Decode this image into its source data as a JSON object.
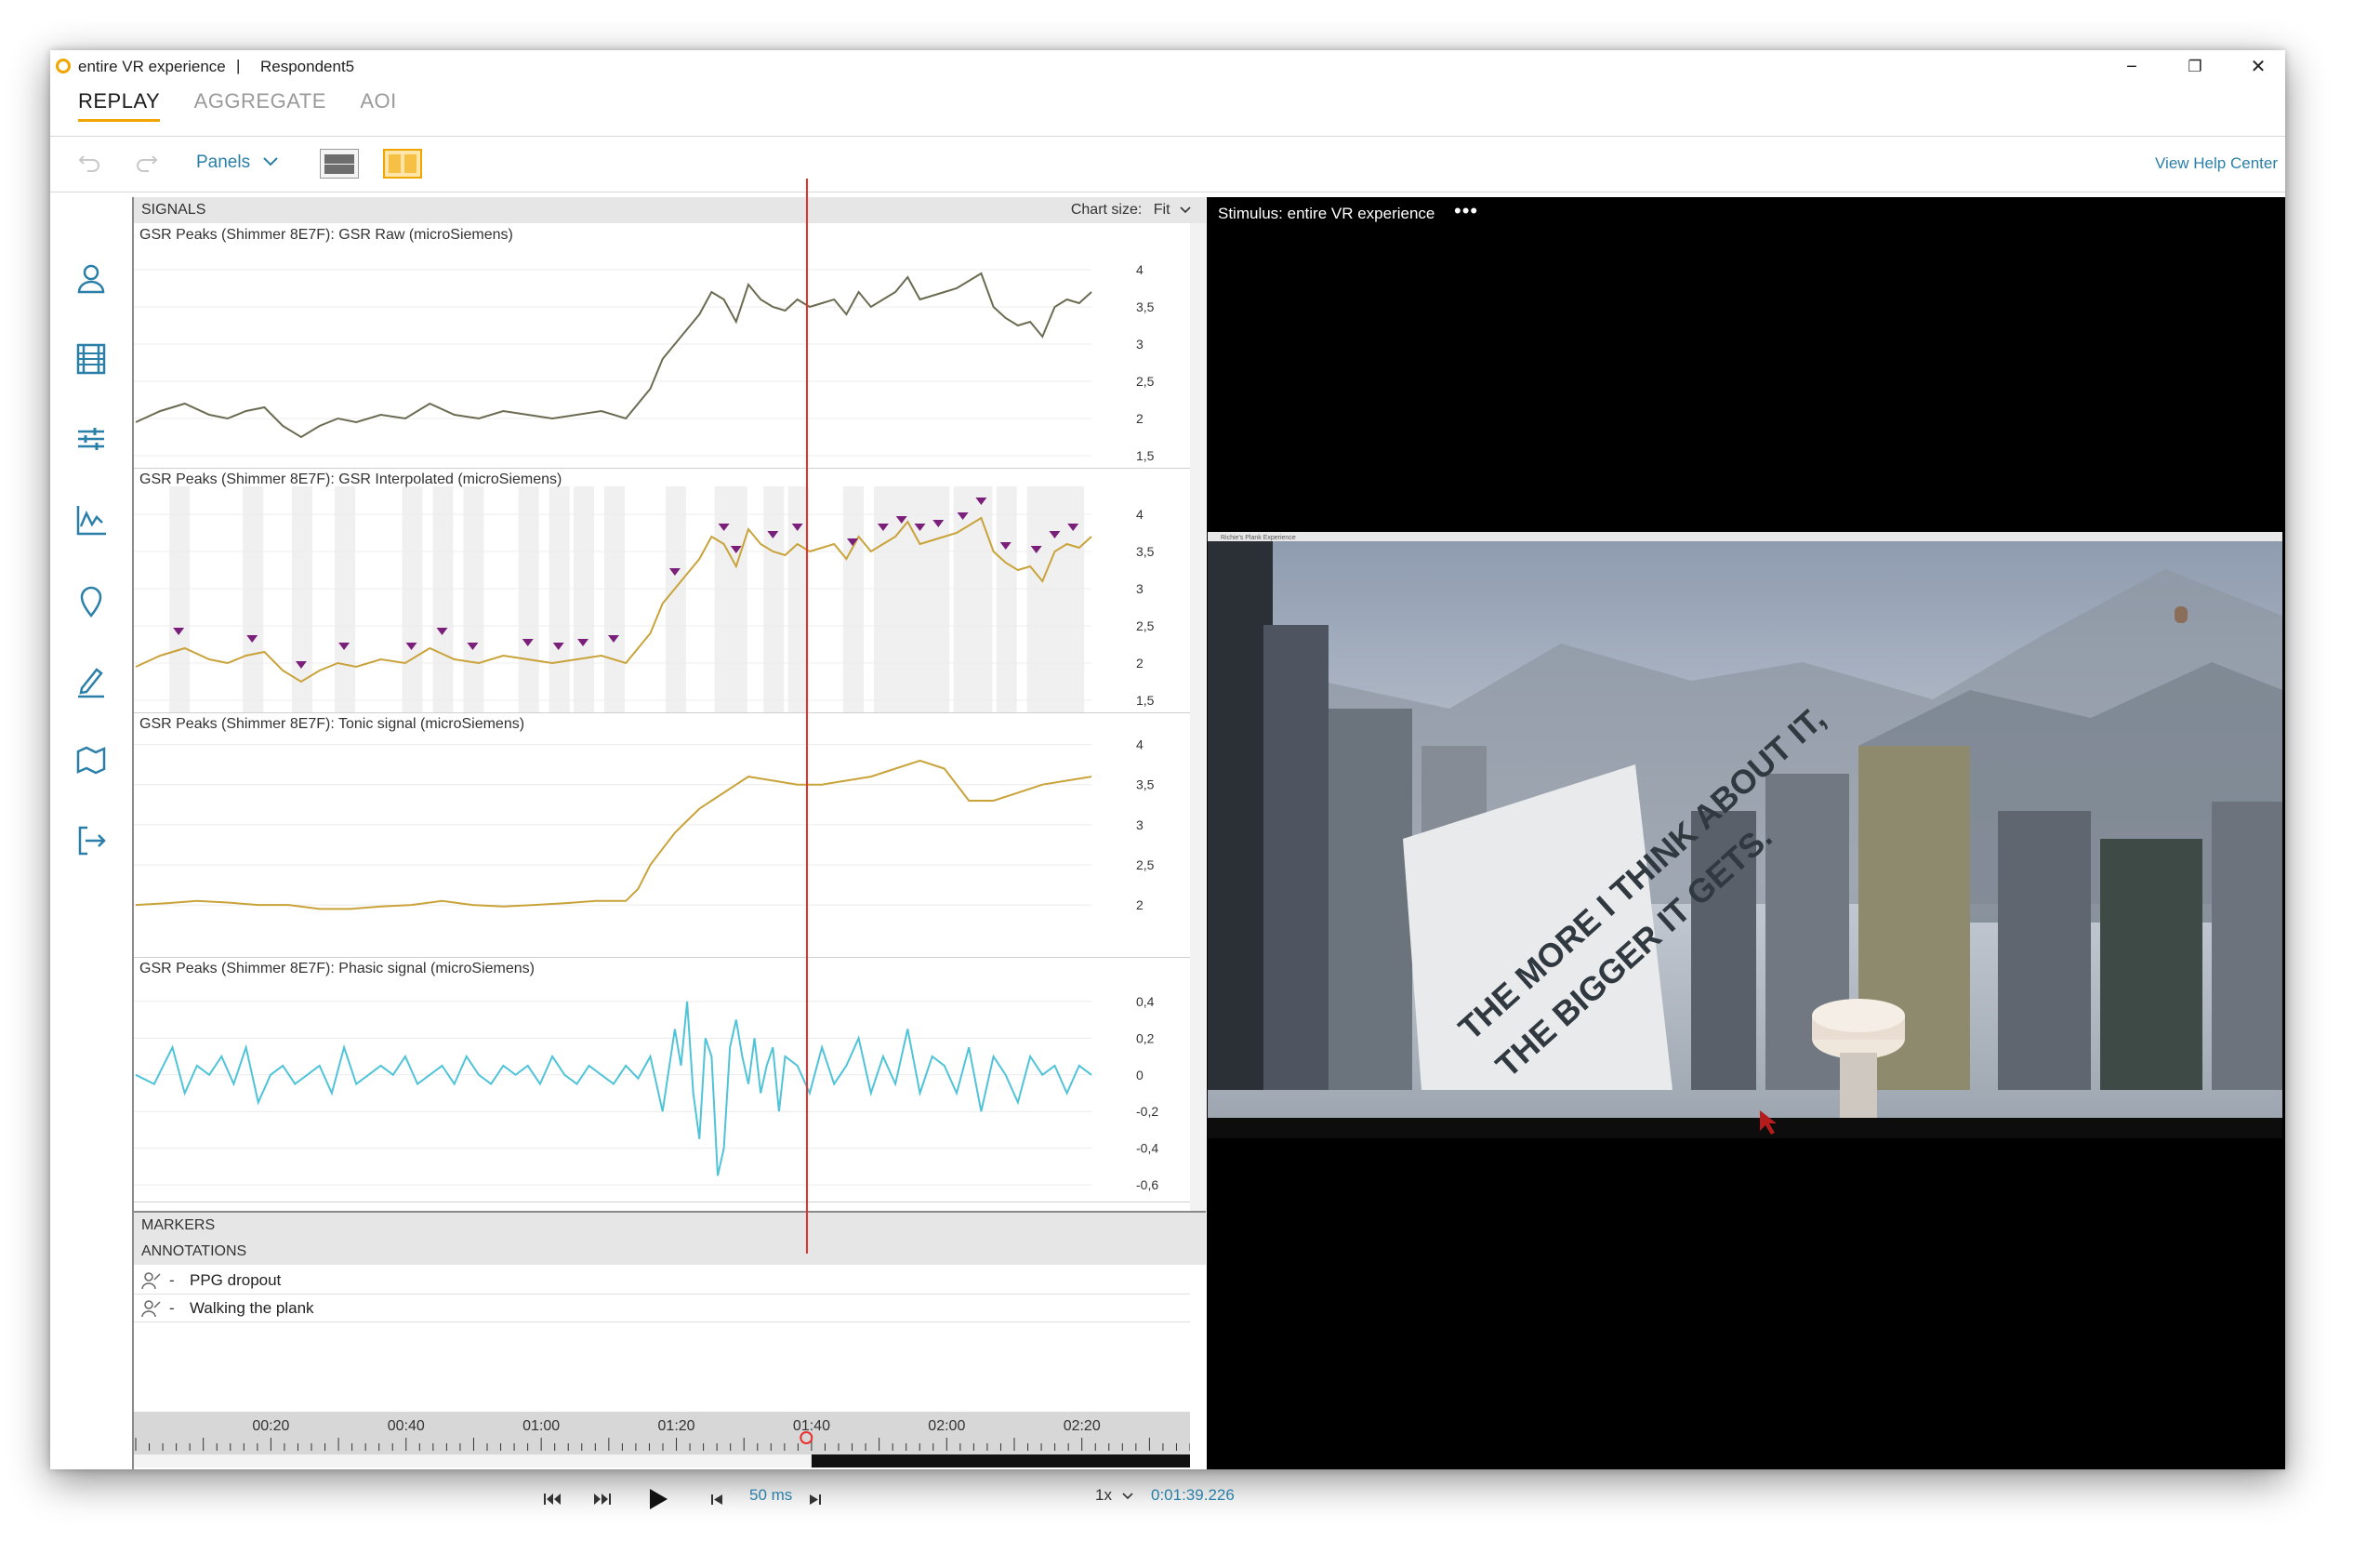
{
  "window": {
    "title": "entire VR experience",
    "separator": "|",
    "respondent": "Respondent5",
    "controls": {
      "minimize": "−",
      "restore": "❐",
      "close": "✕"
    }
  },
  "tabs": [
    {
      "label": "REPLAY",
      "active": true
    },
    {
      "label": "AGGREGATE",
      "active": false
    },
    {
      "label": "AOI",
      "active": false
    }
  ],
  "toolbar": {
    "undo_icon": "undo-icon",
    "redo_icon": "redo-icon",
    "panels_label": "Panels",
    "help_link": "View Help Center"
  },
  "sidebar": {
    "icons": [
      "person-icon",
      "film-icon",
      "sliders-icon",
      "chart-icon",
      "location-pin-icon",
      "pencil-icon",
      "map-icon",
      "export-icon"
    ]
  },
  "signals_panel": {
    "header": "SIGNALS",
    "chart_size_label": "Chart size:",
    "chart_size_value": "Fit"
  },
  "chart_data": [
    {
      "type": "line",
      "title": "GSR Peaks (Shimmer 8E7F): GSR Raw (microSiemens)",
      "y_ticks": [
        "4",
        "3,5",
        "3",
        "2,5",
        "2",
        "1,5"
      ],
      "y_tick_values": [
        4,
        3.5,
        3,
        2.5,
        2,
        1.5
      ],
      "ylim": [
        1.5,
        4.2
      ],
      "color": "#6b6b52",
      "series": [
        {
          "x": [
            0,
            4,
            8,
            12,
            15,
            18,
            21,
            24,
            27,
            30,
            33,
            36,
            40,
            44,
            48,
            52,
            56,
            60,
            64,
            68,
            72,
            76,
            80,
            84,
            86,
            88,
            90,
            92,
            94,
            96,
            98,
            100,
            102,
            104,
            106,
            108,
            110,
            112,
            114,
            116,
            118,
            120,
            122,
            124,
            126,
            128,
            130,
            132,
            134,
            136,
            138,
            140,
            142,
            144,
            146,
            148,
            150,
            152,
            154,
            156
          ],
          "y": [
            1.95,
            2.1,
            2.2,
            2.05,
            2.0,
            2.1,
            2.15,
            1.9,
            1.75,
            1.9,
            2.0,
            1.95,
            2.05,
            2.0,
            2.2,
            2.05,
            2.0,
            2.1,
            2.05,
            2.0,
            2.05,
            2.1,
            2.0,
            2.4,
            2.8,
            3.0,
            3.2,
            3.4,
            3.7,
            3.6,
            3.3,
            3.8,
            3.6,
            3.5,
            3.45,
            3.6,
            3.5,
            3.55,
            3.6,
            3.4,
            3.7,
            3.5,
            3.6,
            3.7,
            3.9,
            3.6,
            3.65,
            3.7,
            3.75,
            3.85,
            3.95,
            3.5,
            3.35,
            3.25,
            3.3,
            3.1,
            3.5,
            3.6,
            3.55,
            3.7
          ]
        }
      ]
    },
    {
      "type": "line",
      "title": "GSR Peaks (Shimmer 8E7F): GSR Interpolated (microSiemens)",
      "y_ticks": [
        "4",
        "3,5",
        "3",
        "2,5",
        "2",
        "1,5"
      ],
      "y_tick_values": [
        4,
        3.5,
        3,
        2.5,
        2,
        1.5
      ],
      "ylim": [
        1.5,
        4.2
      ],
      "color": "#c9a33a",
      "series": [
        {
          "x": [
            0,
            4,
            8,
            12,
            15,
            18,
            21,
            24,
            27,
            30,
            33,
            36,
            40,
            44,
            48,
            52,
            56,
            60,
            64,
            68,
            72,
            76,
            80,
            84,
            86,
            88,
            90,
            92,
            94,
            96,
            98,
            100,
            102,
            104,
            106,
            108,
            110,
            112,
            114,
            116,
            118,
            120,
            122,
            124,
            126,
            128,
            130,
            132,
            134,
            136,
            138,
            140,
            142,
            144,
            146,
            148,
            150,
            152,
            154,
            156
          ],
          "y": [
            1.95,
            2.1,
            2.2,
            2.05,
            2.0,
            2.1,
            2.15,
            1.9,
            1.75,
            1.9,
            2.0,
            1.95,
            2.05,
            2.0,
            2.2,
            2.05,
            2.0,
            2.1,
            2.05,
            2.0,
            2.05,
            2.1,
            2.0,
            2.4,
            2.8,
            3.0,
            3.2,
            3.4,
            3.7,
            3.6,
            3.3,
            3.8,
            3.6,
            3.5,
            3.45,
            3.6,
            3.5,
            3.55,
            3.6,
            3.4,
            3.7,
            3.5,
            3.6,
            3.7,
            3.9,
            3.6,
            3.65,
            3.7,
            3.75,
            3.85,
            3.95,
            3.5,
            3.35,
            3.25,
            3.3,
            3.1,
            3.5,
            3.6,
            3.55,
            3.7
          ]
        }
      ],
      "peaks_x": [
        7,
        19,
        27,
        34,
        45,
        50,
        55,
        64,
        69,
        73,
        78,
        88,
        96,
        98,
        104,
        108,
        117,
        122,
        125,
        128,
        131,
        135,
        138,
        142,
        147,
        150,
        153
      ]
    },
    {
      "type": "line",
      "title": "GSR Peaks (Shimmer 8E7F): Tonic signal (microSiemens)",
      "y_ticks": [
        "4",
        "3,5",
        "3",
        "2,5",
        "2"
      ],
      "y_tick_values": [
        4,
        3.5,
        3,
        2.5,
        2
      ],
      "ylim": [
        1.85,
        4.1
      ],
      "color": "#c9a33a",
      "series": [
        {
          "x": [
            0,
            5,
            10,
            15,
            20,
            25,
            30,
            35,
            40,
            45,
            50,
            55,
            60,
            65,
            70,
            75,
            80,
            82,
            84,
            86,
            88,
            90,
            92,
            94,
            96,
            98,
            100,
            104,
            108,
            112,
            116,
            120,
            124,
            128,
            132,
            136,
            140,
            144,
            148,
            152,
            156
          ],
          "y": [
            2.0,
            2.02,
            2.05,
            2.03,
            2.0,
            2.0,
            1.95,
            1.95,
            1.98,
            2.0,
            2.05,
            2.0,
            1.98,
            2.0,
            2.02,
            2.05,
            2.05,
            2.2,
            2.5,
            2.7,
            2.9,
            3.05,
            3.2,
            3.3,
            3.4,
            3.5,
            3.6,
            3.55,
            3.5,
            3.5,
            3.55,
            3.6,
            3.7,
            3.8,
            3.7,
            3.3,
            3.3,
            3.4,
            3.5,
            3.55,
            3.6
          ]
        }
      ]
    },
    {
      "type": "line",
      "title": "GSR Peaks (Shimmer 8E7F): Phasic signal (microSiemens)",
      "y_ticks": [
        "0,4",
        "0,2",
        "0",
        "-0,2",
        "-0,4",
        "-0,6"
      ],
      "y_tick_values": [
        0.4,
        0.2,
        0,
        -0.2,
        -0.4,
        -0.6
      ],
      "ylim": [
        -0.65,
        0.45
      ],
      "color": "#4fc3d8",
      "series": [
        {
          "x": [
            0,
            3,
            6,
            8,
            10,
            12,
            14,
            16,
            18,
            20,
            22,
            24,
            26,
            28,
            30,
            32,
            34,
            36,
            38,
            40,
            42,
            44,
            46,
            48,
            50,
            52,
            54,
            56,
            58,
            60,
            62,
            64,
            66,
            68,
            70,
            72,
            74,
            76,
            78,
            80,
            82,
            84,
            86,
            88,
            89,
            90,
            91,
            92,
            93,
            94,
            95,
            96,
            97,
            98,
            99,
            100,
            101,
            102,
            103,
            104,
            105,
            106,
            108,
            110,
            112,
            114,
            116,
            118,
            120,
            122,
            124,
            126,
            128,
            130,
            132,
            134,
            136,
            138,
            140,
            142,
            144,
            146,
            148,
            150,
            152,
            154,
            156
          ],
          "y": [
            0,
            -0.05,
            0.15,
            -0.1,
            0.05,
            0,
            0.1,
            -0.05,
            0.15,
            -0.15,
            0,
            0.05,
            -0.05,
            0,
            0.05,
            -0.1,
            0.15,
            -0.05,
            0,
            0.05,
            0,
            0.1,
            -0.05,
            0,
            0.05,
            -0.05,
            0.1,
            0,
            -0.05,
            0.05,
            0,
            0.05,
            -0.05,
            0.1,
            0,
            -0.05,
            0.05,
            0,
            -0.05,
            0.05,
            -0.02,
            0.1,
            -0.2,
            0.25,
            0.05,
            0.4,
            -0.1,
            -0.35,
            0.2,
            0.1,
            -0.55,
            -0.4,
            0.15,
            0.3,
            0.1,
            -0.05,
            0.2,
            -0.1,
            0.05,
            0.15,
            -0.2,
            0.1,
            0.05,
            -0.1,
            0.15,
            -0.05,
            0.05,
            0.2,
            -0.1,
            0.1,
            -0.05,
            0.25,
            -0.1,
            0.1,
            0.05,
            -0.1,
            0.15,
            -0.2,
            0.1,
            0,
            -0.15,
            0.1,
            0,
            0.05,
            -0.1,
            0.05,
            0
          ]
        }
      ]
    }
  ],
  "markers_panel": {
    "header": "MARKERS"
  },
  "annotations_panel": {
    "header": "ANNOTATIONS",
    "items": [
      {
        "dash": "-",
        "label": "PPG dropout"
      },
      {
        "dash": "-",
        "label": "Walking the plank"
      }
    ]
  },
  "timeline": {
    "labels": [
      "00:20",
      "00:40",
      "01:00",
      "01:20",
      "01:40",
      "02:00",
      "02:20"
    ],
    "cursor_seconds": 99.226,
    "max_seconds": 156
  },
  "playback": {
    "skip_back_icon": "skip-back-icon",
    "skip_forward_icon": "skip-forward-icon",
    "play_icon": "play-icon",
    "step_back_icon": "step-back-icon",
    "step_forward_icon": "step-forward-icon",
    "step_value": "50 ms",
    "speed": "1x",
    "current_time": "0:01:39.226"
  },
  "stimulus": {
    "title": "Stimulus: entire VR experience",
    "more": "•••",
    "billboard_line1": "THE MORE I THINK ABOUT IT,",
    "billboard_line2": "THE BIGGER IT GETS.",
    "vr_window_title": "Richie's Plank Experience"
  }
}
